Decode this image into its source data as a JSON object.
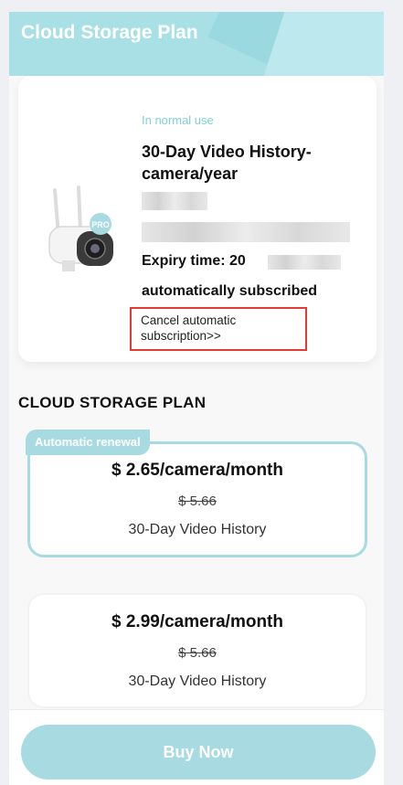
{
  "header": {
    "title": "Cloud Storage Plan"
  },
  "subscription": {
    "status": "In normal use",
    "plan_name": "30-Day Video History-camera/year",
    "expiry_label": "Expiry time: 20",
    "auto_subscribed": "automatically subscribed",
    "cancel_link": "Cancel automatic subscription>>",
    "camera_badge": "PRO"
  },
  "section": {
    "title": "CLOUD STORAGE PLAN"
  },
  "plans": [
    {
      "badge": "Automatic renewal",
      "price": "$ 2.65/camera/month",
      "old_price": "$ 5.66",
      "history": "30-Day Video History"
    },
    {
      "price": "$ 2.99/camera/month",
      "old_price": "$ 5.66",
      "history": "30-Day Video History"
    }
  ],
  "footer": {
    "buy_label": "Buy Now"
  },
  "colors": {
    "accent": "#a8dbe1",
    "status": "#7fd0d8",
    "highlight_border": "#e53935"
  }
}
